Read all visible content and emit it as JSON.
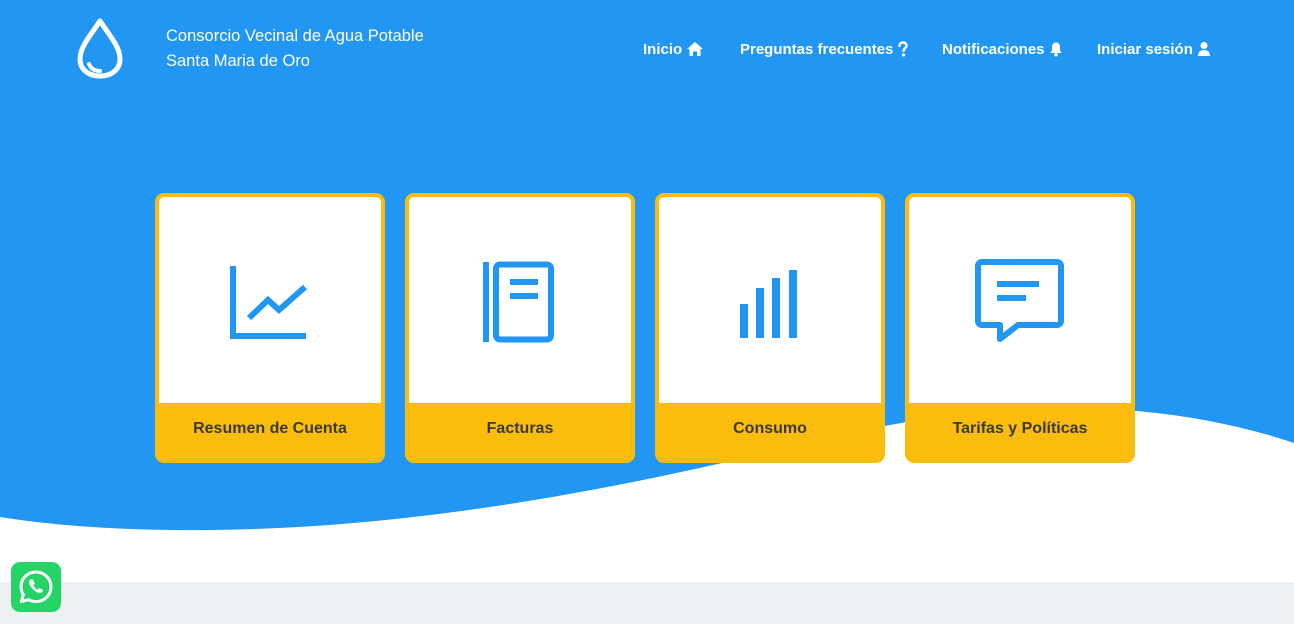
{
  "brand": {
    "line1": "Consorcio Vecinal de Agua Potable",
    "line2": "Santa Maria de Oro",
    "logo_icon": "water-drop-icon"
  },
  "nav": {
    "inicio": {
      "label": "Inicio",
      "icon": "home-icon"
    },
    "preguntas": {
      "label": "Preguntas frecuentes",
      "icon": "question-icon"
    },
    "notificaciones": {
      "label": "Notificaciones",
      "icon": "bell-icon"
    },
    "login": {
      "label": "Iniciar sesión",
      "icon": "user-icon"
    }
  },
  "cards": [
    {
      "label": "Resumen de Cuenta",
      "icon": "line-chart-icon"
    },
    {
      "label": "Facturas",
      "icon": "notebook-icon"
    },
    {
      "label": "Consumo",
      "icon": "bar-chart-icon"
    },
    {
      "label": "Tarifas y Políticas",
      "icon": "message-icon"
    }
  ],
  "whatsapp": {
    "icon": "whatsapp-icon"
  },
  "colors": {
    "primary": "#2196f3",
    "accent": "#fcbc0d",
    "card_text": "#3a3a3a",
    "footer_bg": "#eef1f4",
    "whatsapp": "#25d366"
  }
}
